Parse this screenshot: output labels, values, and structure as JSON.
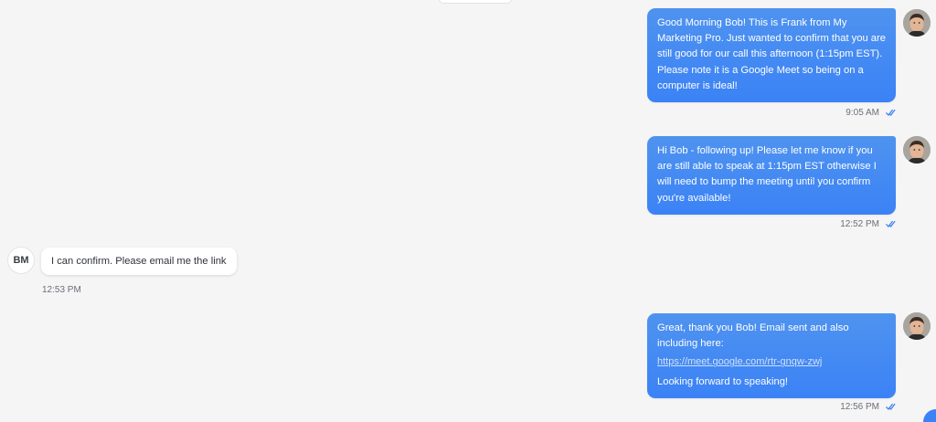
{
  "colors": {
    "outgoing_bubble": "#3b82f6",
    "incoming_bubble": "#ffffff",
    "background": "#f5f5f6",
    "read_check": "#3b82f6"
  },
  "messages": [
    {
      "direction": "outgoing",
      "paragraphs": [
        "Good Morning Bob! This is Frank from My Marketing Pro. Just wanted to confirm that you are still good for our call this afternoon (1:15pm EST). Please note it is a Google Meet so being on a computer is ideal!"
      ],
      "time": "9:05 AM",
      "status_icon": "double-check-icon"
    },
    {
      "direction": "outgoing",
      "paragraphs": [
        "Hi Bob - following up! Please let me know if you are still able to speak at 1:15pm EST otherwise I will need to bump the meeting until you confirm you're available!"
      ],
      "time": "12:52 PM",
      "status_icon": "double-check-icon"
    },
    {
      "direction": "incoming",
      "sender_initials": "BM",
      "text": "I can confirm. Please email me the link",
      "time": "12:53 PM"
    },
    {
      "direction": "outgoing",
      "paragraphs": [
        "Great, thank you Bob! Email sent and also including here:"
      ],
      "link": "https://meet.google.com/rtr-gnqw-zwj",
      "closing": "Looking forward to speaking!",
      "time": "12:56 PM",
      "status_icon": "double-check-icon"
    }
  ]
}
